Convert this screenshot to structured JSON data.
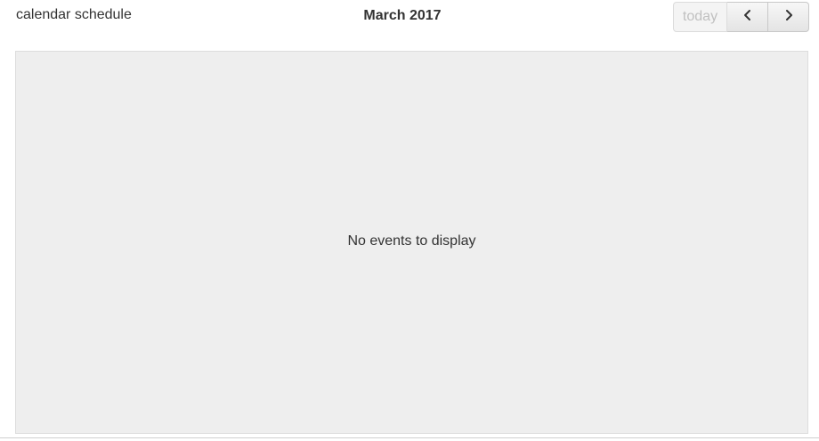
{
  "header": {
    "view_label": "calendar schedule",
    "title": "March 2017",
    "today_label": "today"
  },
  "icons": {
    "prev": "chevron-left-icon",
    "next": "chevron-right-icon"
  },
  "list": {
    "empty_message": "No events to display"
  },
  "colors": {
    "panel_background": "#eeeeee",
    "panel_border": "#dddddd",
    "text": "#333333",
    "disabled_text": "#c0c0c0"
  }
}
